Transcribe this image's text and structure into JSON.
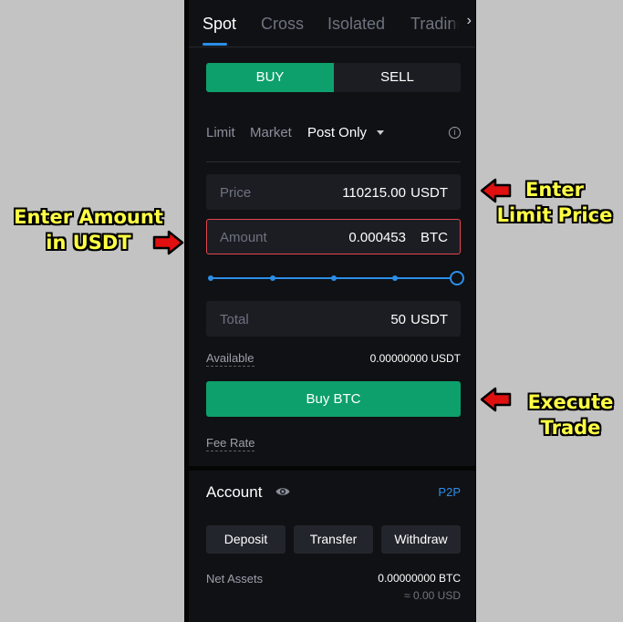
{
  "tabs": [
    "Spot",
    "Cross",
    "Isolated",
    "Trading"
  ],
  "tabs_more_icon": "chevron-right-icon",
  "side_toggle": {
    "buy": "BUY",
    "sell": "SELL",
    "selected": "BUY"
  },
  "order_types": {
    "limit": "Limit",
    "market": "Market",
    "post_only": "Post Only",
    "selected": "Post Only"
  },
  "price_field": {
    "label": "Price",
    "value": "110215.00",
    "unit": "USDT"
  },
  "amount_field": {
    "label": "Amount",
    "value": "0.000453",
    "unit": "BTC"
  },
  "slider": {
    "percent": 100,
    "marks": [
      0,
      25,
      50,
      75,
      100
    ]
  },
  "total_field": {
    "label": "Total",
    "value": "50",
    "unit": "USDT"
  },
  "available": {
    "label": "Available",
    "value": "0.00000000 USDT"
  },
  "buy_button": "Buy BTC",
  "fee_rate": "Fee Rate",
  "account": {
    "title": "Account",
    "p2p": "P2P",
    "deposit": "Deposit",
    "transfer": "Transfer",
    "withdraw": "Withdraw",
    "net_assets_label": "Net Assets",
    "net_assets_btc": "0.00000000 BTC",
    "net_assets_usd": "≈ 0.00 USD"
  },
  "annotations": {
    "amount": {
      "line1": "Enter Amount",
      "line2": "in USDT"
    },
    "price": {
      "line1": "Enter",
      "line2": "Limit Price"
    },
    "execute": {
      "line1": "Execute",
      "line2": "Trade"
    }
  },
  "colors": {
    "buy_green": "#0ea06c",
    "accent_blue": "#2b8ee8",
    "focus_red": "#e2474d",
    "annotation_yellow": "#ffff44",
    "arrow_red": "#e01010"
  }
}
